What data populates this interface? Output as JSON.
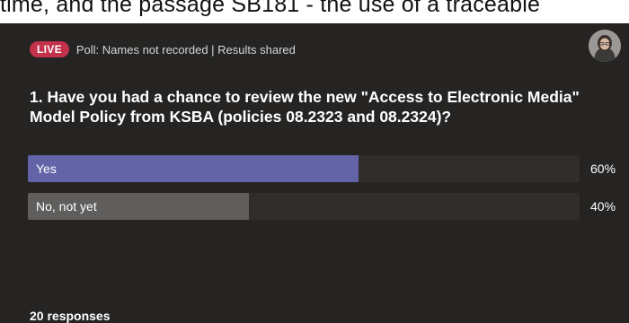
{
  "background_text": "time, and the passage SB181 - the use of a traceable",
  "header": {
    "live_label": "LIVE",
    "subtitle": "Poll: Names not recorded | Results shared"
  },
  "question": "1. Have you had a chance to review the new \"Access to Electronic Media\" Model Policy from KSBA (policies 08.2323 and 08.2324)?",
  "options": [
    {
      "label": "Yes",
      "percent_label": "60%",
      "fraction": 0.6,
      "color": "#6264a7"
    },
    {
      "label": "No, not yet",
      "percent_label": "40%",
      "fraction": 0.4,
      "color": "#605e5c"
    }
  ],
  "responses": "20 responses",
  "colors": {
    "card_background": "#252423",
    "live_badge": "#c4314b",
    "yes_bar": "#6264a7",
    "no_bar": "#605e5c"
  }
}
